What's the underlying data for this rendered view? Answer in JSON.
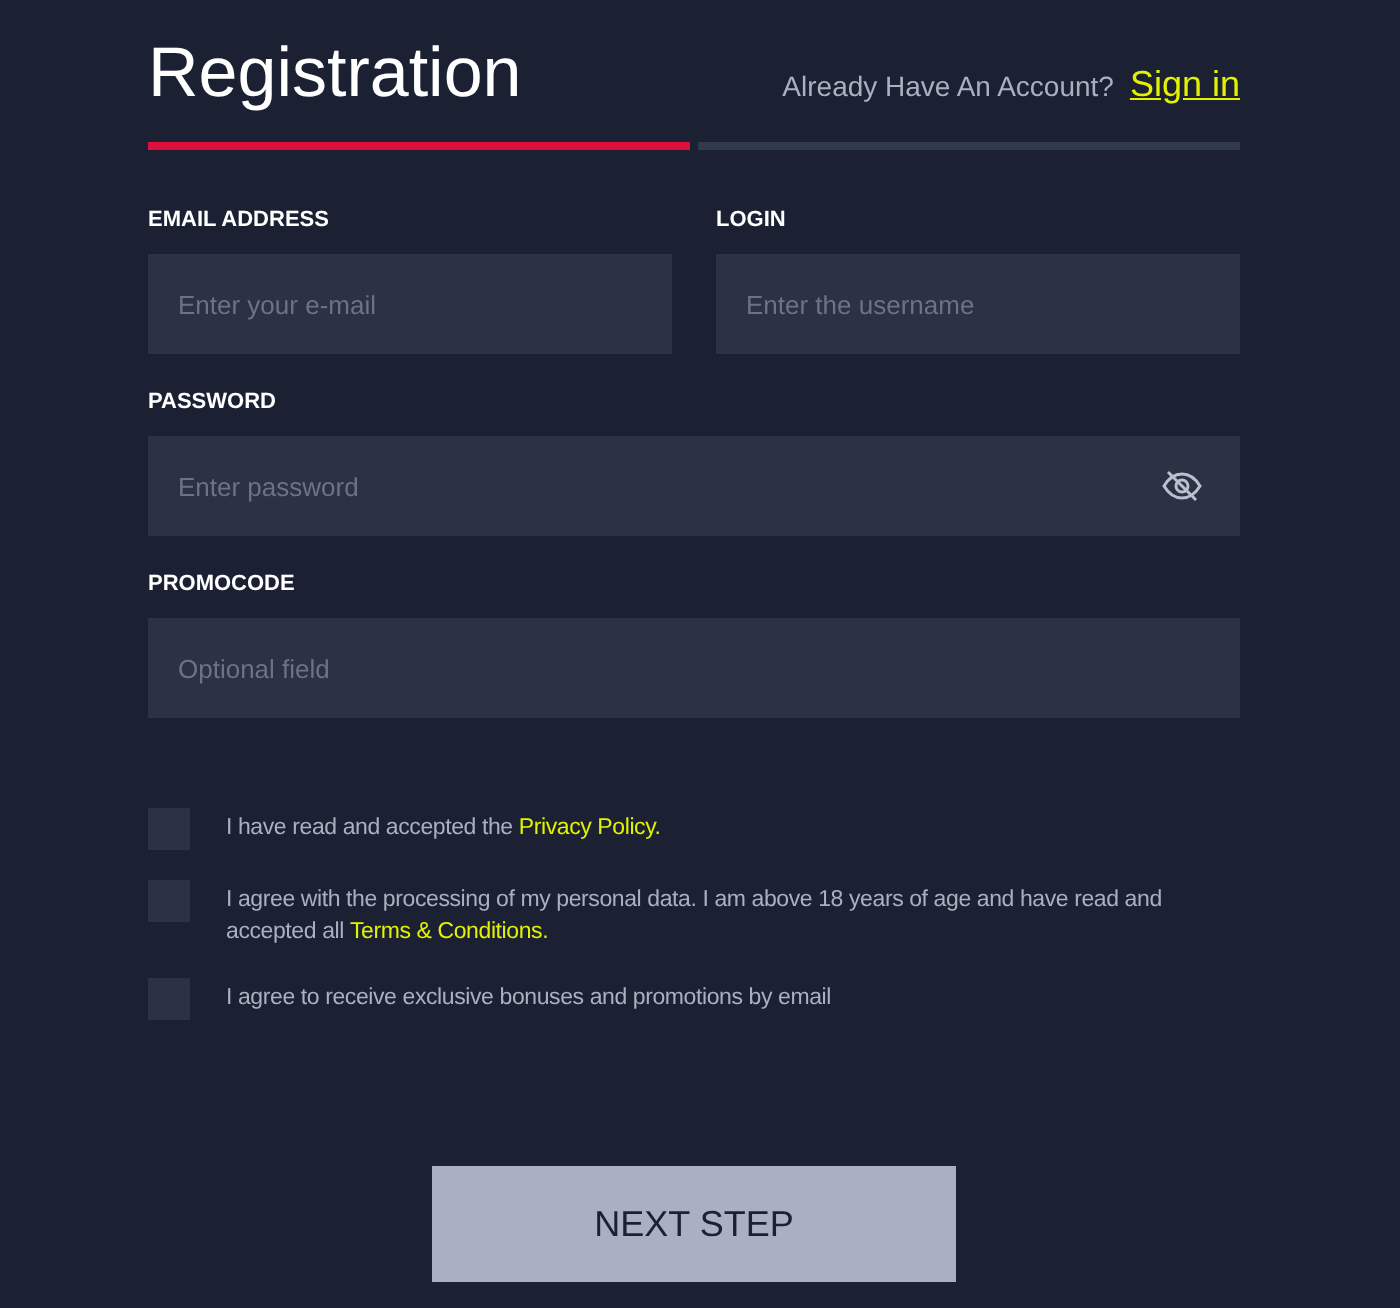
{
  "header": {
    "title": "Registration",
    "account_prompt": "Already Have An Account?",
    "sign_in_link": "Sign in"
  },
  "steps": [
    {
      "selected": true
    },
    {
      "selected": false
    }
  ],
  "fields": [
    {
      "label": "EMAIL ADDRESS",
      "placeholder": "Enter your e-mail",
      "kind": "text",
      "wide": false
    },
    {
      "label": "LOGIN",
      "placeholder": "Enter the username",
      "kind": "text",
      "wide": false
    },
    {
      "label": "PASSWORD",
      "placeholder": "Enter password",
      "kind": "password",
      "wide": true
    },
    {
      "label": "PROMOCODE",
      "placeholder": "Optional field",
      "kind": "text",
      "wide": true
    }
  ],
  "agreements": [
    {
      "text": "I have read and accepted the",
      "link": "Privacy Policy.",
      "checked": false
    },
    {
      "text": "I agree with the processing of my personal data. I am above 18 years of age and have read and accepted all",
      "link": "Terms & Conditions.",
      "checked": false
    },
    {
      "text": "I agree to receive exclusive bonuses and promotions by email",
      "checked": false
    }
  ],
  "submit_button": "NEXT STEP"
}
